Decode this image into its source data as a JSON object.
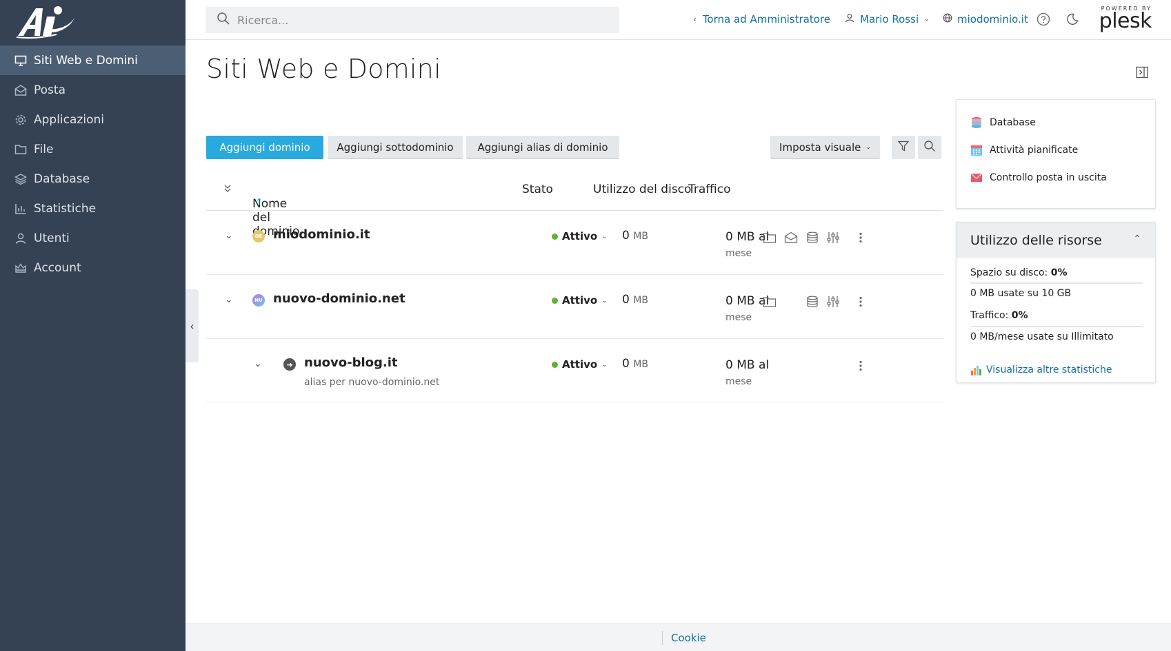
{
  "sidebar": {
    "items": [
      {
        "label": "Siti Web e Domini",
        "icon": "monitor-icon"
      },
      {
        "label": "Posta",
        "icon": "mail-icon"
      },
      {
        "label": "Applicazioni",
        "icon": "gear-icon"
      },
      {
        "label": "File",
        "icon": "folder-icon"
      },
      {
        "label": "Database",
        "icon": "layers-icon"
      },
      {
        "label": "Statistiche",
        "icon": "bar-chart-icon"
      },
      {
        "label": "Utenti",
        "icon": "user-icon"
      },
      {
        "label": "Account",
        "icon": "crown-icon"
      }
    ]
  },
  "header": {
    "search_placeholder": "Ricerca...",
    "back_link": "Torna ad Amministratore",
    "user": "Mario Rossi",
    "domain": "miodominio.it",
    "powered_by": "POWERED BY",
    "brand": "plesk"
  },
  "page": {
    "title": "Siti Web e Domini"
  },
  "toolbar": {
    "add_domain": "Aggiungi dominio",
    "add_subdomain": "Aggiungi sottodominio",
    "add_alias": "Aggiungi alias di dominio",
    "view": "Imposta visuale"
  },
  "table": {
    "headers": {
      "name": "Nome del dominio",
      "status": "Stato",
      "disk": "Utilizzo del disco",
      "traffic": "Traffico"
    },
    "rows": [
      {
        "name": "miodominio.it",
        "badge": "DE",
        "status": "Attivo",
        "disk_value": "0",
        "disk_unit": "MB",
        "traffic_value": "0 MB al",
        "traffic_unit": "mese"
      },
      {
        "name": "nuovo-dominio.net",
        "badge": "NU",
        "status": "Attivo",
        "disk_value": "0",
        "disk_unit": "MB",
        "traffic_value": "0 MB al",
        "traffic_unit": "mese"
      },
      {
        "name": "nuovo-blog.it",
        "sub": "alias per nuovo-dominio.net",
        "status": "Attivo",
        "disk_value": "0",
        "disk_unit": "MB",
        "traffic_value": "0 MB al",
        "traffic_unit": "mese"
      }
    ]
  },
  "quick_links": {
    "database": "Database",
    "scheduled": "Attività pianificate",
    "outgoing_mail": "Controllo posta in uscita"
  },
  "resources": {
    "title": "Utilizzo delle risorse",
    "disk_label": "Spazio su disco:",
    "disk_percent": "0%",
    "disk_detail": "0 MB usate su 10 GB",
    "traffic_label": "Traffico:",
    "traffic_percent": "0%",
    "traffic_detail": "0 MB/mese usate su Illimitato",
    "more_stats": "Visualizza altre statistiche"
  },
  "footer": {
    "cookie": "Cookie"
  },
  "colors": {
    "sidebar_bg": "#354253",
    "primary": "#28aade",
    "link": "#136e9e",
    "status_active": "#5fb135"
  }
}
